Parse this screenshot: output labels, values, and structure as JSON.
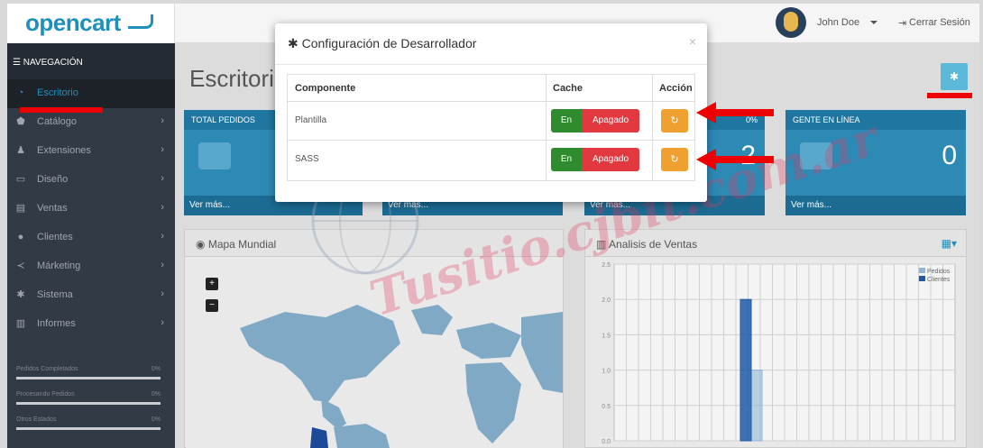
{
  "header": {
    "logo": "opencart",
    "user_name": "John Doe",
    "logout_label": "Cerrar Sesión",
    "logout_icon": "sign-out-icon"
  },
  "sidebar": {
    "nav_header": "NAVEGACIÓN",
    "items": [
      {
        "label": "Escritorio",
        "icon": "dashboard-icon",
        "active": true
      },
      {
        "label": "Catálogo",
        "icon": "tag-icon"
      },
      {
        "label": "Extensiones",
        "icon": "puzzle-icon"
      },
      {
        "label": "Diseño",
        "icon": "desktop-icon"
      },
      {
        "label": "Ventas",
        "icon": "shopping-cart-icon"
      },
      {
        "label": "Clientes",
        "icon": "user-icon"
      },
      {
        "label": "Márketing",
        "icon": "share-icon"
      },
      {
        "label": "Sistema",
        "icon": "cog-icon"
      },
      {
        "label": "Informes",
        "icon": "bar-chart-icon"
      }
    ],
    "stats": [
      {
        "label": "Pedidos Completados",
        "pct": "0%"
      },
      {
        "label": "Procesando Pedidos",
        "pct": "0%"
      },
      {
        "label": "Otros Estados",
        "pct": "0%"
      }
    ]
  },
  "content": {
    "page_title": "Escritorio",
    "tiles": [
      {
        "heading": "TOTAL PEDIDOS",
        "pct": "",
        "value": "",
        "footer": "Ver más..."
      },
      {
        "heading": "",
        "pct": "",
        "value": "",
        "footer": "Ver más..."
      },
      {
        "heading": "",
        "pct": "0%",
        "value": "2",
        "footer": "Ver más..."
      },
      {
        "heading": "GENTE EN LÍNEA",
        "pct": "",
        "value": "0",
        "footer": "Ver más..."
      }
    ],
    "map_panel_title": "Mapa Mundial",
    "sales_panel_title": "Analisis de Ventas",
    "zoom_in": "+",
    "zoom_out": "−"
  },
  "modal": {
    "title": "Configuración de Desarrollador",
    "close": "×",
    "columns": [
      "Componente",
      "Cache",
      "Acción"
    ],
    "rows": [
      {
        "component": "Plantilla",
        "on_label": "En",
        "off_label": "Apagado"
      },
      {
        "component": "SASS",
        "on_label": "En",
        "off_label": "Apagado"
      }
    ]
  },
  "watermark": {
    "text": "Tusitio.cjbit.com.ar"
  },
  "chart_data": {
    "type": "bar",
    "title": "Analisis de Ventas",
    "series": [
      {
        "name": "Pedidos",
        "values": [
          1.0
        ],
        "color": "#8fb5d6"
      },
      {
        "name": "Clientes",
        "values": [
          2.0
        ],
        "color": "#1c5aa6"
      }
    ],
    "yticks": [
      "0.0",
      "0.5",
      "1.0",
      "1.5",
      "2.0",
      "2.5"
    ],
    "ylim": [
      0,
      2.5
    ],
    "legend": "top-right"
  }
}
